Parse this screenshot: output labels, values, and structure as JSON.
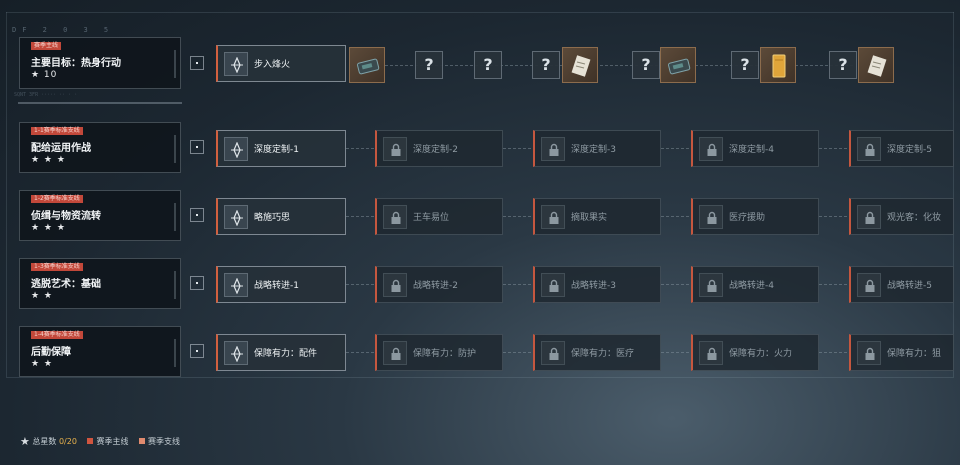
{
  "hud": {
    "corner_code": "DF 2 0 3 5",
    "divider_code": "SQNT 3FR ·····  ·· ·  ·"
  },
  "quests": [
    {
      "tag": "赛季主线",
      "title": "主要目标：热身行动",
      "stars": "★ 10",
      "tag_color": "#c2483a",
      "tasks": [
        {
          "label": "步入烽火",
          "state": "active"
        }
      ]
    },
    {
      "tag": "1-1赛季标准支线",
      "title": "配给运用作战",
      "stars": "★ ★ ★",
      "tag_color": "#c2483a",
      "tasks": [
        {
          "label": "深度定制-1",
          "state": "active"
        },
        {
          "label": "深度定制-2",
          "state": "locked"
        },
        {
          "label": "深度定制-3",
          "state": "locked"
        },
        {
          "label": "深度定制-4",
          "state": "locked"
        },
        {
          "label": "深度定制-5",
          "state": "locked"
        }
      ]
    },
    {
      "tag": "1-2赛季标准支线",
      "title": "侦缉与物资流转",
      "stars": "★ ★ ★",
      "tag_color": "#c2483a",
      "tasks": [
        {
          "label": "略施巧思",
          "state": "active"
        },
        {
          "label": "王车易位",
          "state": "locked"
        },
        {
          "label": "摘取果实",
          "state": "locked"
        },
        {
          "label": "医疗援助",
          "state": "locked"
        },
        {
          "label": "观光客：化妆",
          "state": "locked"
        }
      ]
    },
    {
      "tag": "1-3赛季标准支线",
      "title": "逃脱艺术：基础",
      "stars": "★ ★",
      "tag_color": "#c2483a",
      "tasks": [
        {
          "label": "战略转进-1",
          "state": "active"
        },
        {
          "label": "战略转进-2",
          "state": "locked"
        },
        {
          "label": "战略转进-3",
          "state": "locked"
        },
        {
          "label": "战略转进-4",
          "state": "locked"
        },
        {
          "label": "战略转进-5",
          "state": "locked"
        }
      ]
    },
    {
      "tag": "1-4赛季标准支线",
      "title": "后勤保障",
      "stars": "★ ★",
      "tag_color": "#c2483a",
      "tasks": [
        {
          "label": "保障有力：配件",
          "state": "active"
        },
        {
          "label": "保障有力：防护",
          "state": "locked"
        },
        {
          "label": "保障有力：医疗",
          "state": "locked"
        },
        {
          "label": "保障有力：火力",
          "state": "locked"
        },
        {
          "label": "保障有力：狙",
          "state": "locked"
        }
      ]
    }
  ],
  "rewards": [
    {
      "kind": "item",
      "icon": "ammo-box-icon"
    },
    {
      "kind": "unknown",
      "text": "?"
    },
    {
      "kind": "unknown",
      "text": "?"
    },
    {
      "kind": "unknown",
      "text": "?"
    },
    {
      "kind": "item",
      "icon": "document-icon"
    },
    {
      "kind": "unknown",
      "text": "?"
    },
    {
      "kind": "item",
      "icon": "ammo-box-icon"
    },
    {
      "kind": "unknown",
      "text": "?"
    },
    {
      "kind": "item",
      "icon": "gold-item-icon"
    },
    {
      "kind": "unknown",
      "text": "?"
    },
    {
      "kind": "item",
      "icon": "document-icon"
    }
  ],
  "footer": {
    "total_label": "总星数",
    "total_value": "0/20",
    "legend": [
      {
        "label": "赛季主线",
        "color": "#d0553f"
      },
      {
        "label": "赛季支线",
        "color": "#e08a6e"
      }
    ]
  },
  "colors": {
    "accent": "#c5573f",
    "star_count": "#e8b24c"
  }
}
